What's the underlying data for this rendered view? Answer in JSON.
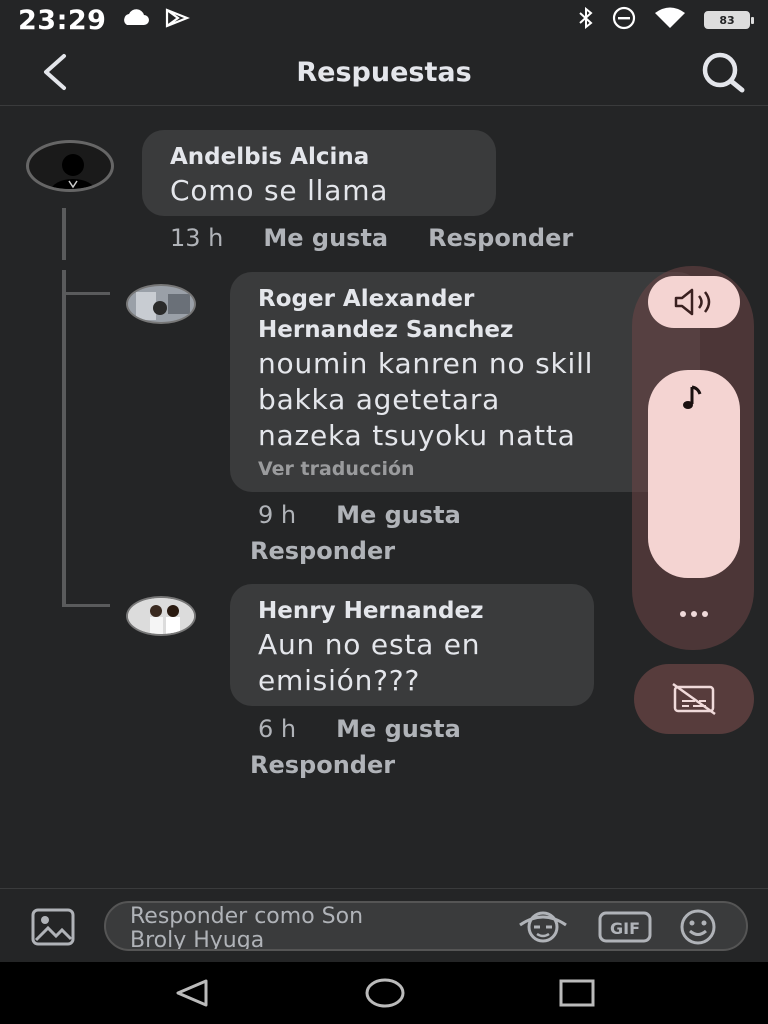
{
  "status_bar": {
    "time": "23:29",
    "battery": "83"
  },
  "header": {
    "title": "Respuestas"
  },
  "comments": [
    {
      "author": "Andelbis Alcina",
      "text": "Como se llama",
      "time": "13 h",
      "like_label": "Me gusta",
      "reply_label": "Responder"
    },
    {
      "author_line1": "Roger Alexander",
      "author_line2": "Hernandez Sanchez",
      "text_line1": "noumin kanren no skill",
      "text_line2": "bakka agetetara",
      "text_line3": "nazeka tsuyoku natta",
      "translate_label": "Ver traducción",
      "time": "9 h",
      "like_label": "Me gusta",
      "reply_label": "Responder"
    },
    {
      "author": "Henry Hernandez",
      "text_line1": "Aun no esta en",
      "text_line2": "emisión???",
      "time": "6 h",
      "like_label": "Me gusta",
      "reply_label": "Responder"
    }
  ],
  "composer": {
    "placeholder_line1": "Responder como Son",
    "placeholder_line2": "Broly Hyuga",
    "gif_label": "GIF"
  },
  "icons": {
    "back": "chevron-left-icon",
    "search": "search-icon",
    "volume": "volume-icon",
    "music": "music-note-icon",
    "more": "more-dots-icon",
    "captions_off": "captions-off-icon",
    "image": "image-icon",
    "avatar_sticker": "avatar-sticker-icon",
    "gif": "gif-icon",
    "emoji": "emoji-icon"
  },
  "colors": {
    "background": "#242526",
    "bubble": "#3a3b3c",
    "floating_accent": "#f4d4d2"
  }
}
